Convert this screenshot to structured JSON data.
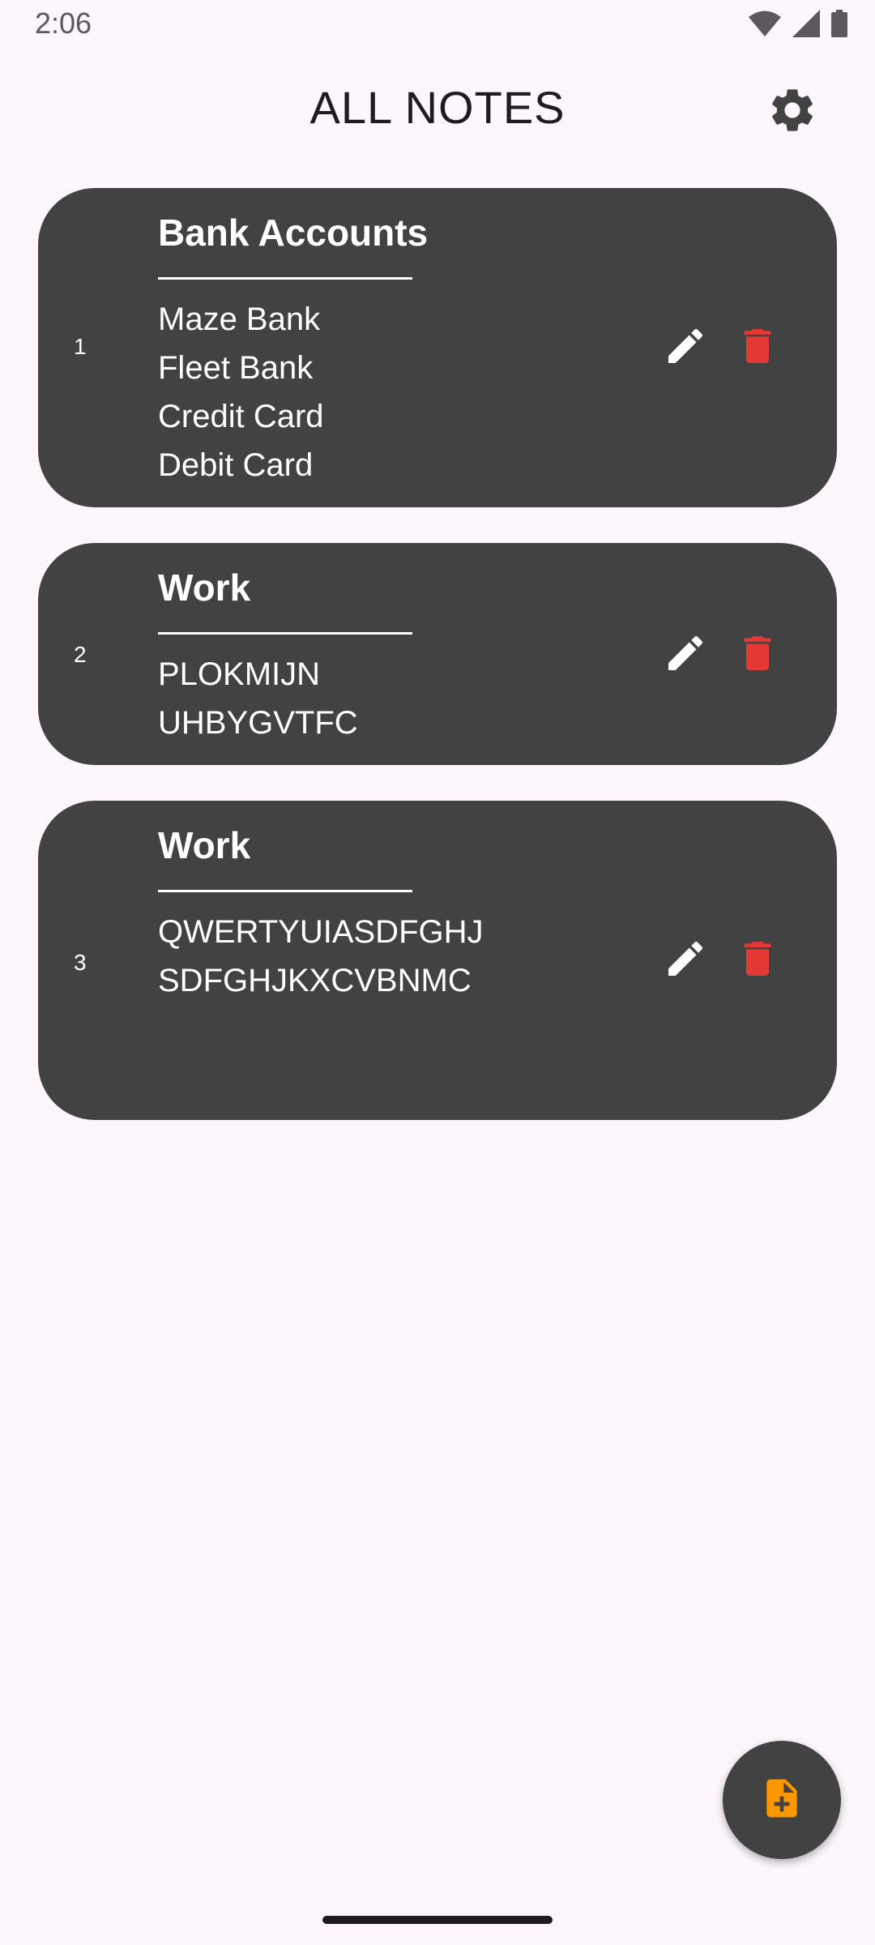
{
  "status_bar": {
    "time": "2:06",
    "icons": [
      "wifi-icon",
      "cellular-signal-icon",
      "battery-icon"
    ]
  },
  "header": {
    "title": "ALL NOTES",
    "settings_icon": "gear-icon"
  },
  "notes": [
    {
      "number": "1",
      "title": "Bank Accounts",
      "lines": [
        "Maze Bank",
        "Fleet Bank",
        "Credit Card",
        "Debit Card"
      ]
    },
    {
      "number": "2",
      "title": "Work",
      "lines": [
        "PLOKMIJN",
        "UHBYGVTFC"
      ]
    },
    {
      "number": "3",
      "title": "Work",
      "lines": [
        "QWERTYUIASDFGHJ",
        "SDFGHJKXCVBNMC"
      ]
    }
  ],
  "fab": {
    "icon": "add-note-icon"
  },
  "colors": {
    "background": "#fdf6fc",
    "card": "#424242",
    "delete": "#e53935",
    "fab_icon": "#ff9800",
    "text_on_card": "#ffffff"
  }
}
